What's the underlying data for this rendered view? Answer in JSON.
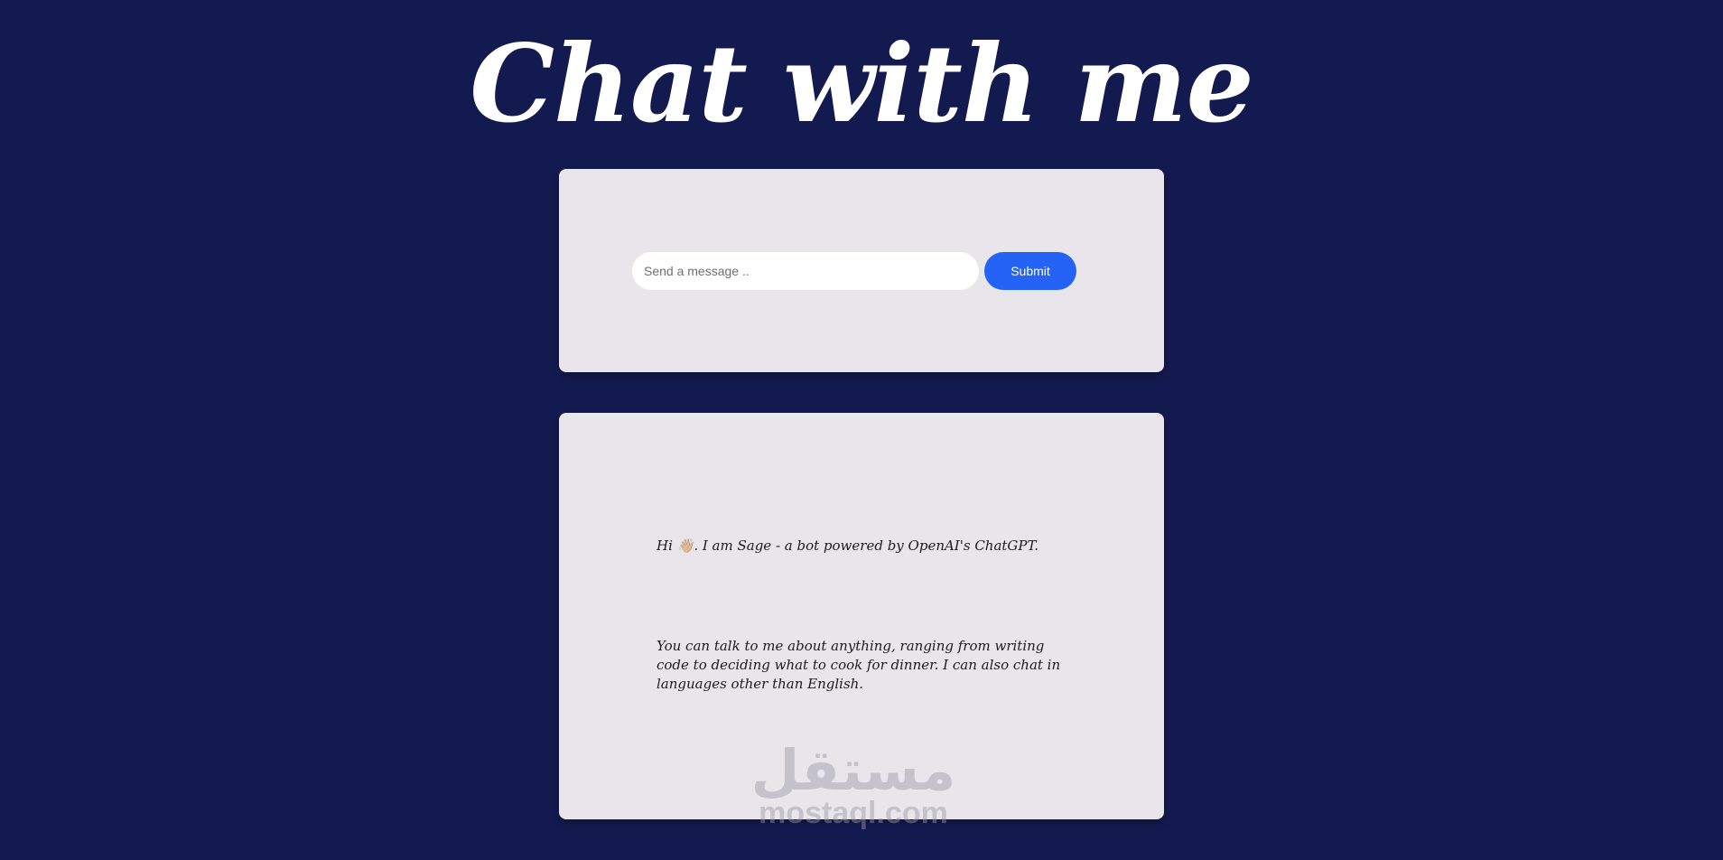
{
  "header": {
    "title": "Chat with me"
  },
  "composer": {
    "placeholder": "Send a message ..",
    "value": "",
    "submit_label": "Submit"
  },
  "chat": {
    "messages": [
      {
        "text": "Hi 👋🏼. I am Sage - a bot powered by OpenAI's ChatGPT."
      },
      {
        "text": "You can talk to me about anything, ranging from writing code to deciding what to cook for dinner. I can also chat in languages other than English."
      }
    ]
  },
  "watermark": {
    "logo_text": "مستقل",
    "domain": "mostaql.com"
  },
  "colors": {
    "background": "#131a4f",
    "panel": "#e8e6ea",
    "accent": "#2563f6"
  }
}
